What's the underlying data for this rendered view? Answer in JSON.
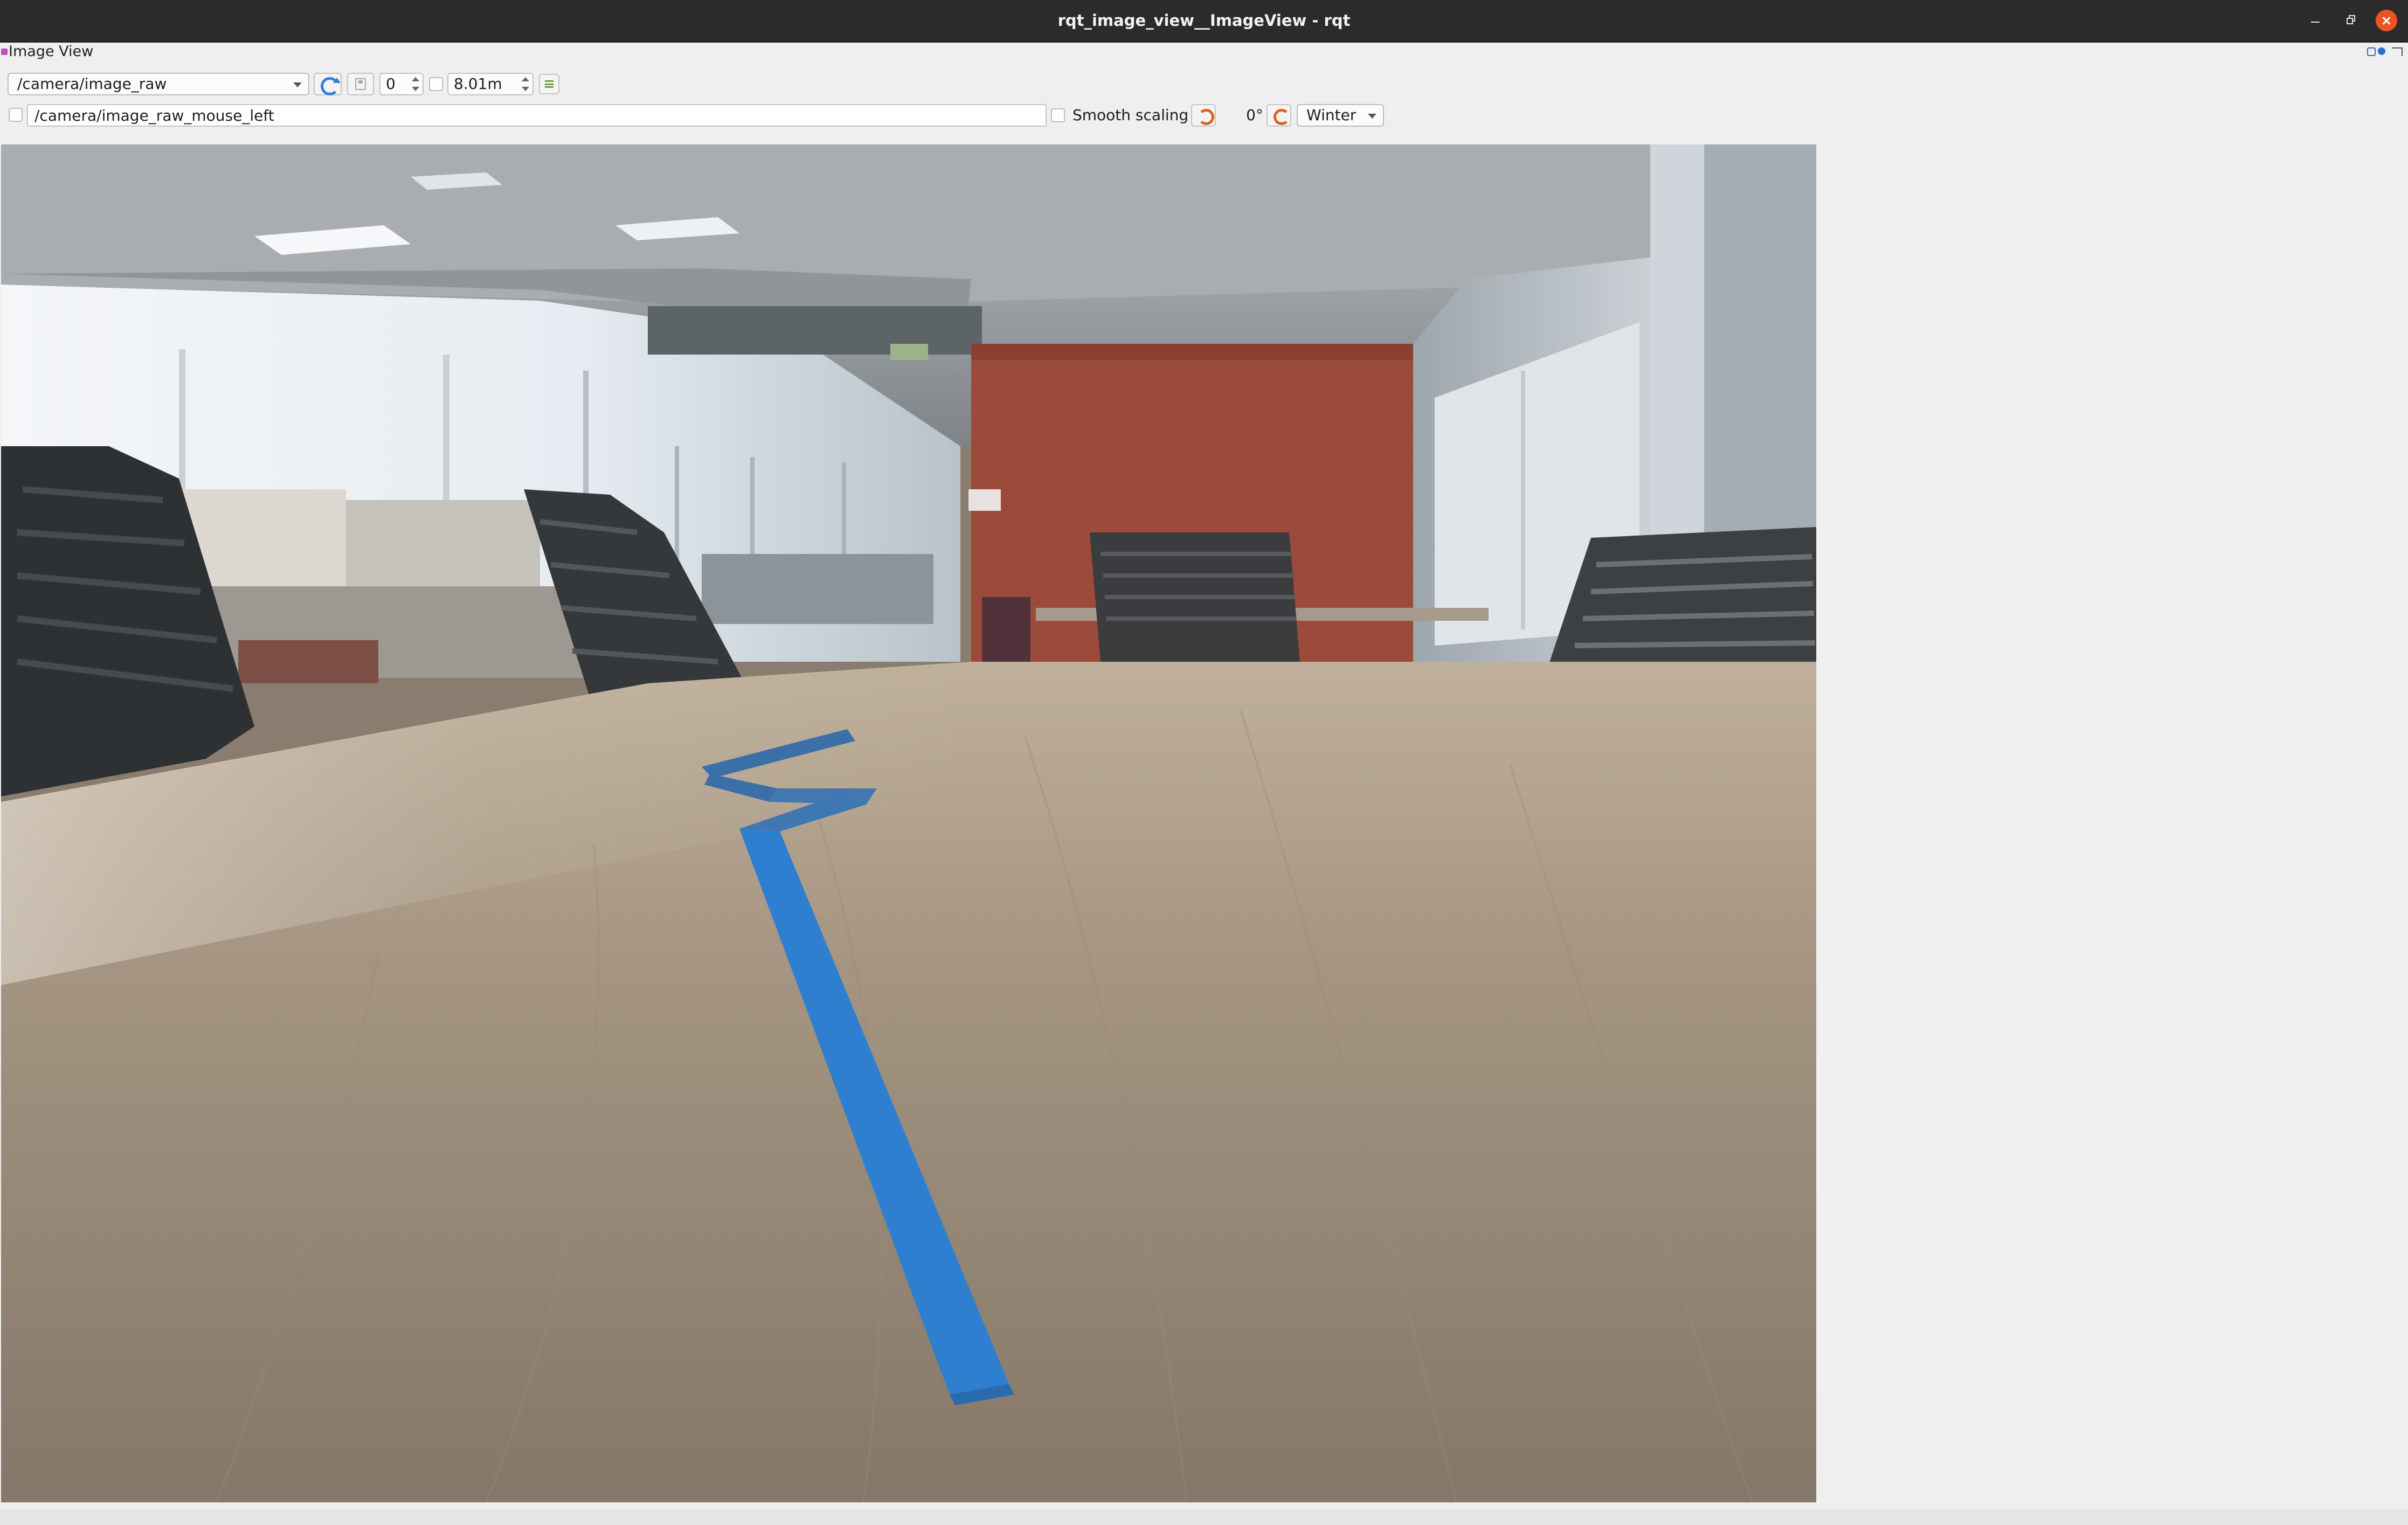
{
  "window": {
    "title": "rqt_image_view__ImageView - rqt"
  },
  "plugin": {
    "title": "Image View"
  },
  "toolbar": {
    "topic": "/camera/image_raw",
    "num_gridlines": "0",
    "max_depth": "8.01m"
  },
  "mouse_bar": {
    "mouse_topic": "/camera/image_raw_mouse_left",
    "smooth_scaling_label": "Smooth scaling",
    "rotation": "0°",
    "colormap": "Winter"
  },
  "colors": {
    "titlebar": "#2b2b2b",
    "close_button": "#e95420",
    "tape": "#2f7fd0",
    "accent_refresh": "#2f80d8",
    "accent_rotate": "#e0601a"
  }
}
